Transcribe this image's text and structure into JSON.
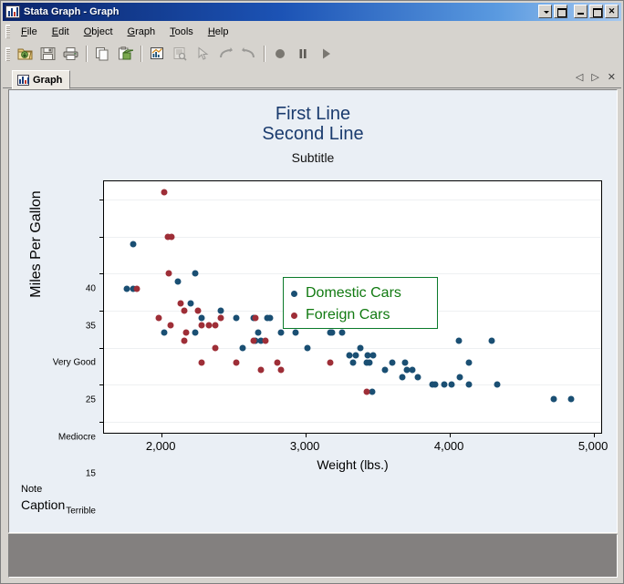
{
  "window": {
    "title": "Stata Graph - Graph",
    "icon": "stata-graph-icon",
    "controls": [
      {
        "name": "dropdown-button",
        "glyph": "wb-down"
      },
      {
        "name": "restore-window-button",
        "glyph": "wb-restore"
      },
      {
        "name": "minimize-button",
        "glyph": "wb-min"
      },
      {
        "name": "maximize-button",
        "glyph": "wb-max"
      },
      {
        "name": "close-button",
        "glyph": "wb-close",
        "label": "✕"
      }
    ]
  },
  "menu": {
    "items": [
      {
        "label": "File",
        "accel": "F"
      },
      {
        "label": "Edit",
        "accel": "E"
      },
      {
        "label": "Object",
        "accel": "O"
      },
      {
        "label": "Graph",
        "accel": "G"
      },
      {
        "label": "Tools",
        "accel": "T"
      },
      {
        "label": "Help",
        "accel": "H"
      }
    ]
  },
  "toolbar": {
    "buttons": [
      {
        "name": "open-graph-button",
        "icon": "folder-open-icon",
        "enabled": true
      },
      {
        "name": "save-graph-button",
        "icon": "floppy-save-icon",
        "enabled": true
      },
      {
        "name": "print-graph-button",
        "icon": "printer-icon",
        "enabled": true
      },
      {
        "name": "copy-button",
        "icon": "copy-pages-icon",
        "enabled": true
      },
      {
        "name": "paste-button",
        "icon": "paste-icon",
        "enabled": true
      },
      {
        "name": "start-graph-editor-button",
        "icon": "graph-editor-icon",
        "enabled": true
      },
      {
        "name": "grid-edit-button",
        "icon": "grid-document-icon",
        "enabled": false
      },
      {
        "name": "pointer-tool-button",
        "icon": "arrow-pointer-icon",
        "enabled": false
      },
      {
        "name": "redo-button",
        "icon": "redo-arrow-icon",
        "enabled": false
      },
      {
        "name": "undo-button",
        "icon": "undo-arrow-icon",
        "enabled": false
      },
      {
        "name": "record-button",
        "icon": "record-circle-icon",
        "enabled": true
      },
      {
        "name": "pause-button",
        "icon": "pause-icon",
        "enabled": true
      },
      {
        "name": "play-button",
        "icon": "play-triangle-icon",
        "enabled": true
      }
    ]
  },
  "tabs": {
    "items": [
      {
        "label": "Graph",
        "icon": "graph-tab-icon",
        "active": true
      }
    ],
    "nav": [
      {
        "name": "tab-scroll-left-button",
        "glyph": "◁"
      },
      {
        "name": "tab-scroll-right-button",
        "glyph": "▷"
      },
      {
        "name": "tab-close-button",
        "glyph": "✕"
      }
    ]
  },
  "colors": {
    "domestic": "#1a4f73",
    "foreign": "#9e2e37",
    "title": "#1a3b6e",
    "legend_text": "#117a11",
    "legend_border": "#0a7a2a",
    "plot_bg": "#ffffff",
    "graph_bg": "#eaeff5"
  },
  "chart_data": {
    "type": "scatter",
    "title": "First Line\nSecond Line",
    "title_lines": [
      "First Line",
      "Second Line"
    ],
    "subtitle": "Subtitle",
    "note": "Note",
    "caption": "Caption",
    "xlabel": "Weight (lbs.)",
    "ylabel": "Miles Per Gallon",
    "xlim": [
      1600,
      5050
    ],
    "ylim": [
      8.5,
      42.5
    ],
    "grid": true,
    "legend_position": "top-center-inside",
    "xticks": [
      {
        "value": 2000,
        "label": "2,000"
      },
      {
        "value": 3000,
        "label": "3,000"
      },
      {
        "value": 4000,
        "label": "4,000"
      },
      {
        "value": 5000,
        "label": "5,000"
      }
    ],
    "yticks": [
      {
        "value": 40,
        "label": "40"
      },
      {
        "value": 35,
        "label": "35"
      },
      {
        "value": 30,
        "label": "Very Good"
      },
      {
        "value": 25,
        "label": "25"
      },
      {
        "value": 20,
        "label": "Mediocre"
      },
      {
        "value": 15,
        "label": "15"
      },
      {
        "value": 10,
        "label": "Terrible"
      }
    ],
    "series": [
      {
        "name": "Domestic Cars",
        "color": "#1a4f73",
        "points": [
          [
            1800,
            34
          ],
          [
            1760,
            28
          ],
          [
            1800,
            28
          ],
          [
            2230,
            30
          ],
          [
            2110,
            29
          ],
          [
            2200,
            26
          ],
          [
            2280,
            24
          ],
          [
            2230,
            22
          ],
          [
            2020,
            22
          ],
          [
            2690,
            21
          ],
          [
            2650,
            21
          ],
          [
            2670,
            22
          ],
          [
            2750,
            24
          ],
          [
            2730,
            24
          ],
          [
            2410,
            25
          ],
          [
            2520,
            24
          ],
          [
            2930,
            22
          ],
          [
            3180,
            22
          ],
          [
            3250,
            22
          ],
          [
            3220,
            29
          ],
          [
            3300,
            19
          ],
          [
            3350,
            19
          ],
          [
            3430,
            19
          ],
          [
            3470,
            19
          ],
          [
            3440,
            18
          ],
          [
            3420,
            18
          ],
          [
            3330,
            18
          ],
          [
            3380,
            20
          ],
          [
            3600,
            18
          ],
          [
            3690,
            18
          ],
          [
            3700,
            17
          ],
          [
            3740,
            17
          ],
          [
            3670,
            16
          ],
          [
            3780,
            16
          ],
          [
            3880,
            15
          ],
          [
            3900,
            15
          ],
          [
            3960,
            15
          ],
          [
            4060,
            21
          ],
          [
            4130,
            18
          ],
          [
            4070,
            16
          ],
          [
            4130,
            15
          ],
          [
            4290,
            21
          ],
          [
            4330,
            15
          ],
          [
            4720,
            13
          ],
          [
            4840,
            13
          ],
          [
            2640,
            24
          ],
          [
            2830,
            22
          ],
          [
            3170,
            22
          ],
          [
            3010,
            20
          ],
          [
            2560,
            20
          ],
          [
            3550,
            17
          ],
          [
            3460,
            14
          ],
          [
            4010,
            15
          ]
        ]
      },
      {
        "name": "Foreign Cars",
        "color": "#9e2e37",
        "points": [
          [
            2020,
            41
          ],
          [
            2040,
            35
          ],
          [
            2070,
            35
          ],
          [
            2050,
            30
          ],
          [
            2130,
            26
          ],
          [
            1830,
            28
          ],
          [
            2160,
            25
          ],
          [
            2250,
            25
          ],
          [
            2410,
            24
          ],
          [
            2280,
            23
          ],
          [
            2170,
            22
          ],
          [
            2330,
            23
          ],
          [
            2370,
            23
          ],
          [
            2160,
            21
          ],
          [
            2280,
            18
          ],
          [
            2640,
            21
          ],
          [
            2720,
            21
          ],
          [
            2800,
            18
          ],
          [
            1980,
            24
          ],
          [
            2690,
            17
          ],
          [
            2830,
            17
          ],
          [
            3170,
            18
          ],
          [
            3420,
            14
          ],
          [
            2370,
            20
          ],
          [
            2520,
            18
          ],
          [
            2060,
            23
          ],
          [
            2650,
            24
          ]
        ]
      }
    ]
  }
}
